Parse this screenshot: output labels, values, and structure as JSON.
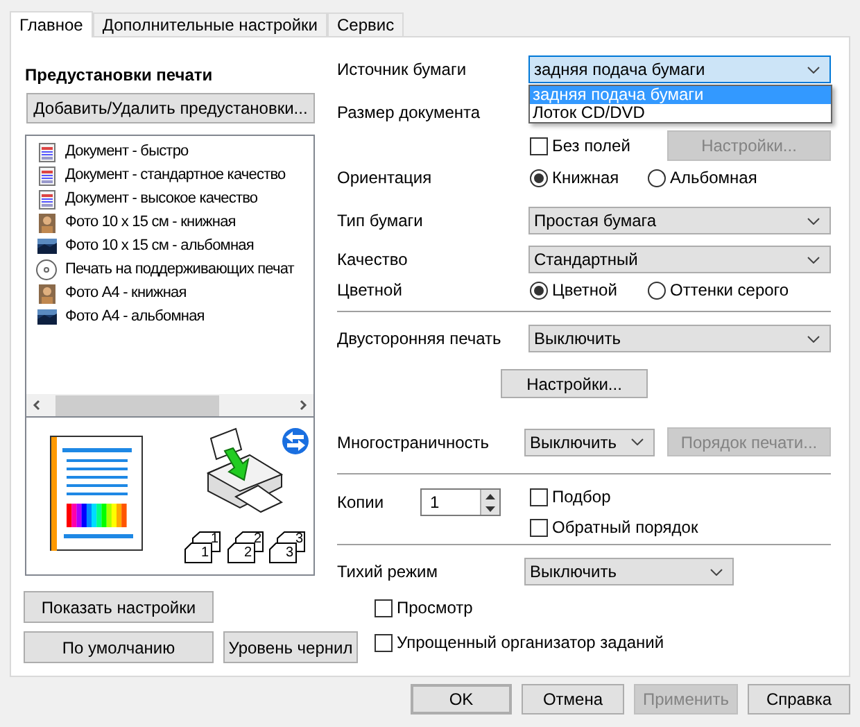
{
  "tabs": [
    {
      "label": "Главное",
      "selected": true
    },
    {
      "label": "Дополнительные настройки",
      "selected": false
    },
    {
      "label": "Сервис",
      "selected": false
    }
  ],
  "presets": {
    "title": "Предустановки печати",
    "add_button": "Добавить/Удалить предустановки...",
    "items": [
      {
        "kind": "document",
        "label": "Документ - быстро"
      },
      {
        "kind": "document",
        "label": "Документ - стандартное качество"
      },
      {
        "kind": "document",
        "label": "Документ - высокое качество"
      },
      {
        "kind": "photo_portrait",
        "label": "Фото 10 x 15 см - книжная"
      },
      {
        "kind": "photo_landscape",
        "label": "Фото 10 x 15 см - альбомная"
      },
      {
        "kind": "disc",
        "label": "Печать на поддерживающих печат"
      },
      {
        "kind": "photo_portrait",
        "label": "Фото А4 - книжная"
      },
      {
        "kind": "photo_landscape",
        "label": "Фото А4 - альбомная"
      }
    ]
  },
  "preview": {
    "collate_pages": [
      {
        "front": "1",
        "back": "1"
      },
      {
        "front": "2",
        "back": "2"
      },
      {
        "front": "3",
        "back": "3"
      }
    ]
  },
  "left_buttons": [
    {
      "label": "Показать настройки"
    },
    {
      "label": "По умолчанию"
    },
    {
      "label": "Уровень чернил"
    }
  ],
  "paper_source": {
    "label": "Источник бумаги",
    "value": "задняя подача бумаги",
    "open": true,
    "options": [
      {
        "label": "задняя подача бумаги",
        "selected": true
      },
      {
        "label": "Лоток CD/DVD",
        "selected": false
      }
    ]
  },
  "document_size": {
    "label": "Размер документа"
  },
  "borderless": {
    "label": "Без полей",
    "checked": false,
    "button": {
      "label": "Настройки...",
      "disabled": true
    }
  },
  "orientation": {
    "label": "Ориентация",
    "options": [
      {
        "label": "Книжная",
        "selected": true
      },
      {
        "label": "Альбомная",
        "selected": false
      }
    ]
  },
  "paper_type": {
    "label": "Тип бумаги",
    "value": "Простая бумага"
  },
  "quality": {
    "label": "Качество",
    "value": "Стандартный"
  },
  "color": {
    "label": "Цветной",
    "options": [
      {
        "label": "Цветной",
        "selected": true
      },
      {
        "label": "Оттенки серого",
        "selected": false
      }
    ]
  },
  "duplex": {
    "label": "Двусторонняя печать",
    "value": "Выключить",
    "button": {
      "label": "Настройки...",
      "disabled": false
    }
  },
  "multipage": {
    "label": "Многостраничность",
    "value": "Выключить",
    "button": {
      "label": "Порядок печати...",
      "disabled": true
    }
  },
  "copies": {
    "label": "Копии",
    "value": "1",
    "options": [
      {
        "label": "Подбор",
        "checked": false
      },
      {
        "label": "Обратный порядок",
        "checked": false
      }
    ]
  },
  "quiet_mode": {
    "label": "Тихий режим",
    "value": "Выключить"
  },
  "extra_options": [
    {
      "label": "Просмотр",
      "checked": false
    },
    {
      "label": "Упрощенный организатор заданий",
      "checked": false
    }
  ],
  "footer_buttons": [
    {
      "label": "OK",
      "default": true,
      "disabled": false
    },
    {
      "label": "Отмена",
      "default": false,
      "disabled": false
    },
    {
      "label": "Применить",
      "default": false,
      "disabled": true
    },
    {
      "label": "Справка",
      "default": false,
      "disabled": false
    }
  ]
}
